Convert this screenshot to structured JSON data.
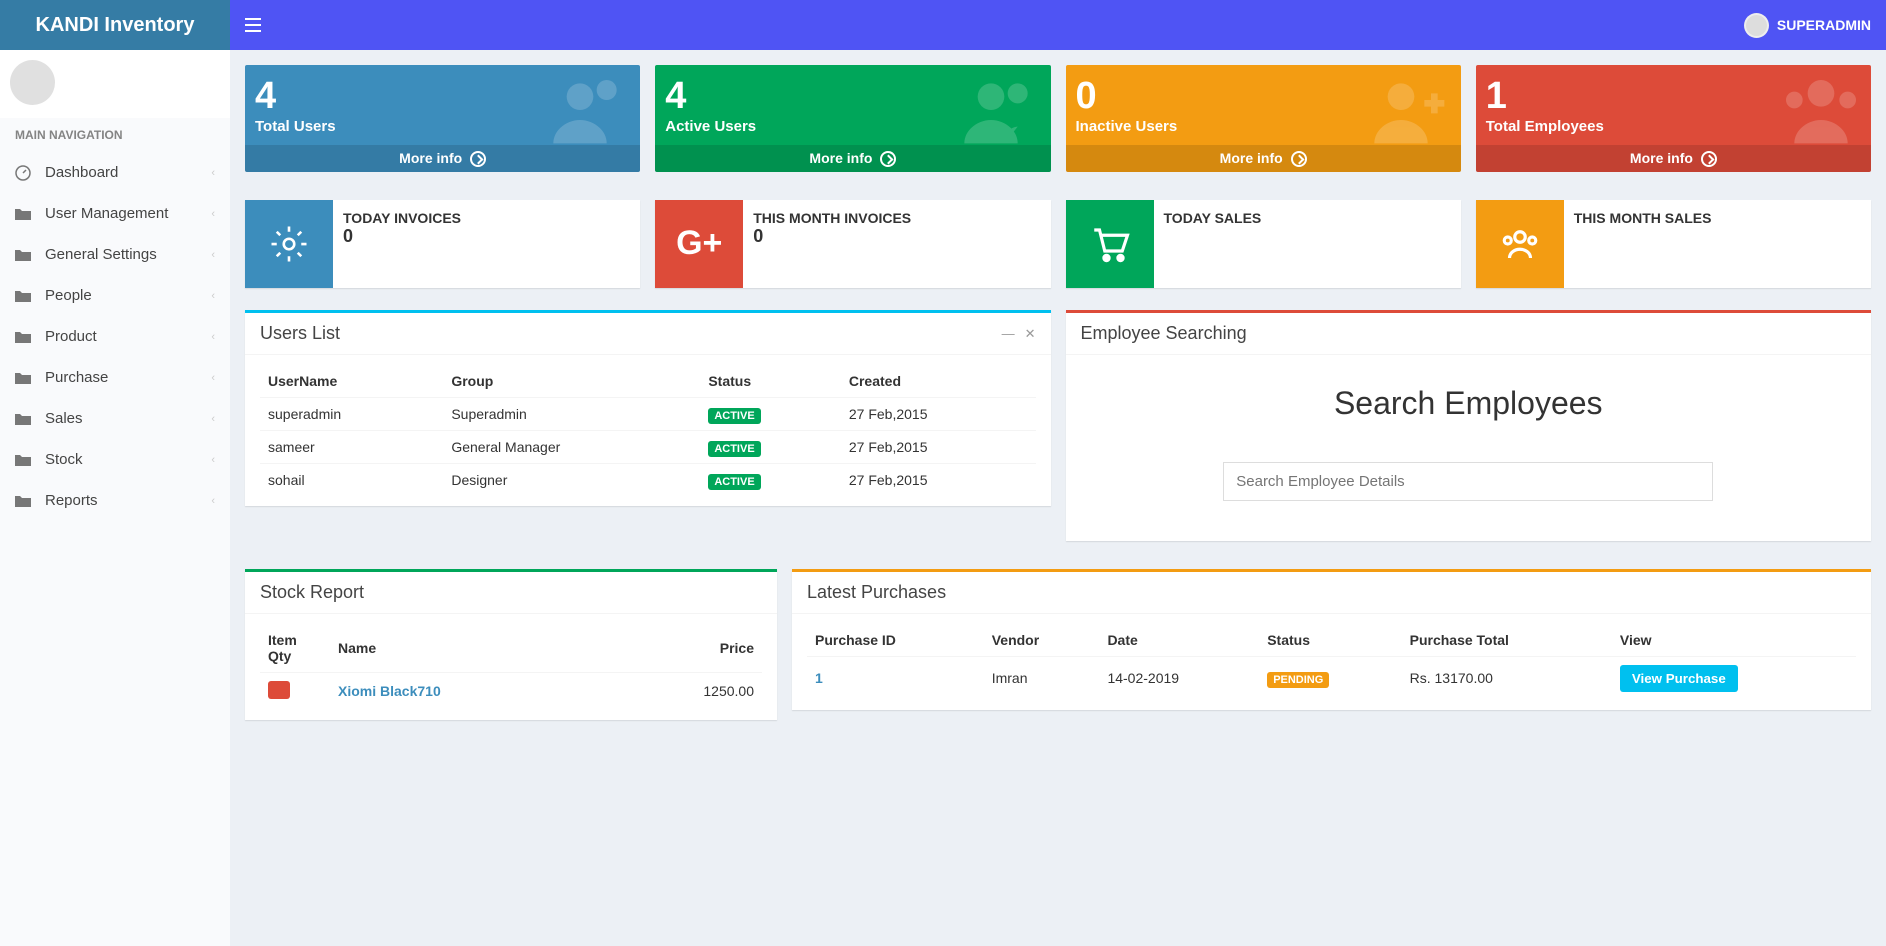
{
  "app": {
    "title": "KANDI Inventory",
    "user": "SUPERADMIN"
  },
  "sidebar": {
    "header": "MAIN NAVIGATION",
    "items": [
      {
        "label": "Dashboard"
      },
      {
        "label": "User Management"
      },
      {
        "label": "General Settings"
      },
      {
        "label": "People"
      },
      {
        "label": "Product"
      },
      {
        "label": "Purchase"
      },
      {
        "label": "Sales"
      },
      {
        "label": "Stock"
      },
      {
        "label": "Reports"
      }
    ]
  },
  "stats": {
    "totalUsers": {
      "value": "4",
      "label": "Total Users",
      "more": "More info"
    },
    "activeUsers": {
      "value": "4",
      "label": "Active Users",
      "more": "More info"
    },
    "inactiveUsers": {
      "value": "0",
      "label": "Inactive Users",
      "more": "More info"
    },
    "totalEmployees": {
      "value": "1",
      "label": "Total Employees",
      "more": "More info"
    }
  },
  "infoBoxes": {
    "todayInvoices": {
      "label": "TODAY INVOICES",
      "value": "0"
    },
    "monthInvoices": {
      "label": "THIS MONTH INVOICES",
      "value": "0"
    },
    "todaySales": {
      "label": "TODAY SALES",
      "value": ""
    },
    "monthSales": {
      "label": "THIS MONTH SALES",
      "value": ""
    }
  },
  "usersList": {
    "title": "Users List",
    "cols": {
      "c0": "UserName",
      "c1": "Group",
      "c2": "Status",
      "c3": "Created"
    },
    "rows": [
      {
        "user": "superadmin",
        "group": "Superadmin",
        "status": "ACTIVE",
        "created": "27 Feb,2015"
      },
      {
        "user": "sameer",
        "group": "General Manager",
        "status": "ACTIVE",
        "created": "27 Feb,2015"
      },
      {
        "user": "sohail",
        "group": "Designer",
        "status": "ACTIVE",
        "created": "27 Feb,2015"
      }
    ]
  },
  "employeeSearch": {
    "title": "Employee Searching",
    "heading": "Search Employees",
    "placeholder": "Search Employee Details"
  },
  "stockReport": {
    "title": "Stock Report",
    "cols": {
      "c0": "Item Qty",
      "c1": "Name",
      "c2": "Price"
    },
    "rows": [
      {
        "name": "Xiomi Black710",
        "price": "1250.00"
      }
    ]
  },
  "latestPurchases": {
    "title": "Latest Purchases",
    "cols": {
      "c0": "Purchase ID",
      "c1": "Vendor",
      "c2": "Date",
      "c3": "Status",
      "c4": "Purchase Total",
      "c5": "View"
    },
    "rows": [
      {
        "id": "1",
        "vendor": "Imran",
        "date": "14-02-2019",
        "status": "PENDING",
        "total": "Rs. 13170.00",
        "view": "View Purchase"
      }
    ]
  }
}
